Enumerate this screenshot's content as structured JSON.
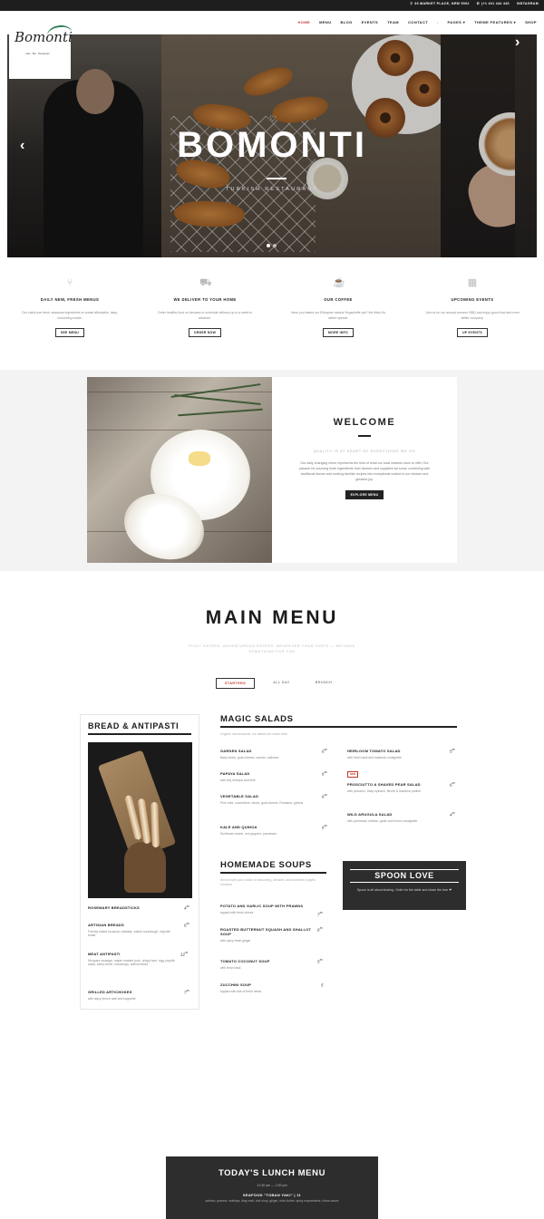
{
  "topbar": {
    "address": "36 MARKET PLACE, NEW 5002",
    "phone": "(+1 401 444 440",
    "social": "INSTAGRAM"
  },
  "brand": {
    "logo_text": "Bomonti",
    "logo_sub": "Cafe · Bar · Restaurant"
  },
  "nav": {
    "items": [
      "HOME",
      "MENU",
      "BLOG",
      "EVENTS",
      "TEAM",
      "CONTACT"
    ],
    "separator": "|",
    "pages": "PAGES ▾",
    "theme_features": "THEME FEATURES ▾",
    "shop": "SHOP",
    "active_index": 0
  },
  "hero": {
    "title": "BOMONTI",
    "subtitle": "TURKISH RESTAURANT",
    "prev": "‹",
    "next": "›",
    "slide_count": 2,
    "active_slide": 0
  },
  "features": [
    {
      "icon": "fork-knife-icon",
      "glyph": "⑂",
      "title": "DAILY NEW, FRESH MENUS",
      "desc": "Our chefs use fresh, seasonal ingredients to create affordable, tasty, nourishing meals.",
      "button": "SEE MENU"
    },
    {
      "icon": "delivery-icon",
      "glyph": "⛟",
      "title": "WE DELIVER TO YOUR HOME",
      "desc": "Order healthy food on demand or schedule delivery up to a week in advance.",
      "button": "ORDER NOW"
    },
    {
      "icon": "coffee-cup-icon",
      "glyph": "☕",
      "title": "OUR COFFEE",
      "desc": "Have you tasted our Ethiopian natural Yirgacheffe yet? We think it's rather special.",
      "button": "MORE INFO"
    },
    {
      "icon": "calendar-icon",
      "glyph": "▦",
      "title": "UPCOMING EVENTS",
      "desc": "Join us for our annual summer BBQ and enjoy good food and even better company.",
      "button": "UP EVENTS"
    }
  ],
  "welcome": {
    "title": "WELCOME",
    "tagline": "QUALITY IS AT HEART OF EVERYTHING WE DO",
    "text": "Our daily changing menu represents the best of what our local markets have to offer. Our passion for sourcing fresh ingredients from farmers and suppliers we know, combining with traditional flavors and cooking familiar recipes into exceptional cuisine is our mission and greatest joy.",
    "button": "EXPLORE MENU"
  },
  "main_menu": {
    "title": "MAIN MENU",
    "subtitle": "PICKY EATERS, ADVENTUROUS EATERS, WHATEVER YOUR TASTE — WE HAVE SOMETHING FOR YOU",
    "tabs": [
      "STARTERS",
      "ALL DAY",
      "BRUNCH"
    ],
    "active_tab": 0
  },
  "bread": {
    "title": "BREAD & ANTIPASTI",
    "items": [
      {
        "name": "ROSEMARY BREADSTICKS",
        "desc": "",
        "price": "4",
        "cents": "50"
      },
      {
        "name": "ARTISIAN BREADS",
        "desc": "Freshly baked focaccia, ciabatta, walnut sourdough, chipotle butter",
        "price": "6",
        "cents": "50"
      },
      {
        "name": "MEAT ANTIPASTI",
        "desc": "Merguez sausage, maple roasted pork, crispy ham, egg, piquillo salsa, salsa verde, manchego, walnut bread",
        "price": "12",
        "cents": "50"
      },
      {
        "name": "GRILLED ARTICHOKES",
        "desc": "with spicy lemon aioli and baguette",
        "price": "7",
        "cents": "50"
      }
    ]
  },
  "salads": {
    "title": "MAGIC SALADS",
    "intro": "Organic and seasonal, our salads are made fresh",
    "left": [
      {
        "name": "GARDEN SALAD",
        "desc": "Baby beets, goat cheese, carrots, radishes",
        "price": "6",
        "cents": "90"
      },
      {
        "name": "PAPAYA SALAD",
        "desc": "with tiny shrimps and lime",
        "price": "6",
        "cents": "90"
      },
      {
        "name": "VEGETABLE SALAD",
        "desc": "Pine nuts, cucumbers, olives, goat cheese, Romaine, greens",
        "price": "6",
        "cents": "90"
      },
      {
        "name": "KALE AND QUINOA",
        "desc": "Sunflower seeds, red peppers, parmesan",
        "price": "6",
        "cents": "90"
      }
    ],
    "right": [
      {
        "name": "HEIRLOOM TOMATO SALAD",
        "desc": "with fresh basil and balsamic vinaigrette",
        "price": "5",
        "cents": "50"
      },
      {
        "name": "PROSCIUTTO & SHAVED PEAR SALAD",
        "desc": "with pecorino, baby spinach, fennel & hazelnut praline",
        "price": "6",
        "cents": "50",
        "badge": "NEW"
      },
      {
        "name": "WILD ARUGULA SALAD",
        "desc": "with parmesan cheese, garlic and lemon vinaigrette",
        "price": "4",
        "cents": "50"
      }
    ]
  },
  "soups": {
    "title": "HOMEMADE SOUPS",
    "intro": "Served with your choice of seasoning, dressed, and crumbed or garlic croutons",
    "items": [
      {
        "name": "POTATO AND GARLIC SOUP WITH PRAWNS",
        "desc": "topped with fresh chives",
        "price": "7",
        "cents": "50"
      },
      {
        "name": "ROASTED BUTTERNUT SQUASH AND SHALLOT SOUP",
        "desc": "with spicy fresh ginger",
        "price": "6",
        "cents": "50"
      },
      {
        "name": "TOMATO COCONUT SOUP",
        "desc": "with fresh basil",
        "price": "5",
        "cents": "50"
      },
      {
        "name": "ZUCCHINI SOUP",
        "desc": "topped with bits of fresh herbs",
        "price": "5",
        "cents": ""
      }
    ]
  },
  "spoon_love": {
    "title": "SPOON LOVE",
    "text": "Spoon is all about sharing. Order for the table and share the love ❤"
  },
  "lunch": {
    "title": "TODAY'S LUNCH MENU",
    "hours": "11:30 am — 2:30 pm",
    "item": "SEAFOOD \"TOBAN YAKI\" | 11",
    "desc": "salmon, prawns, scallops, king crab, bok choy, ginger, miso butter, spicy mayonnaise, citrus sauce"
  }
}
